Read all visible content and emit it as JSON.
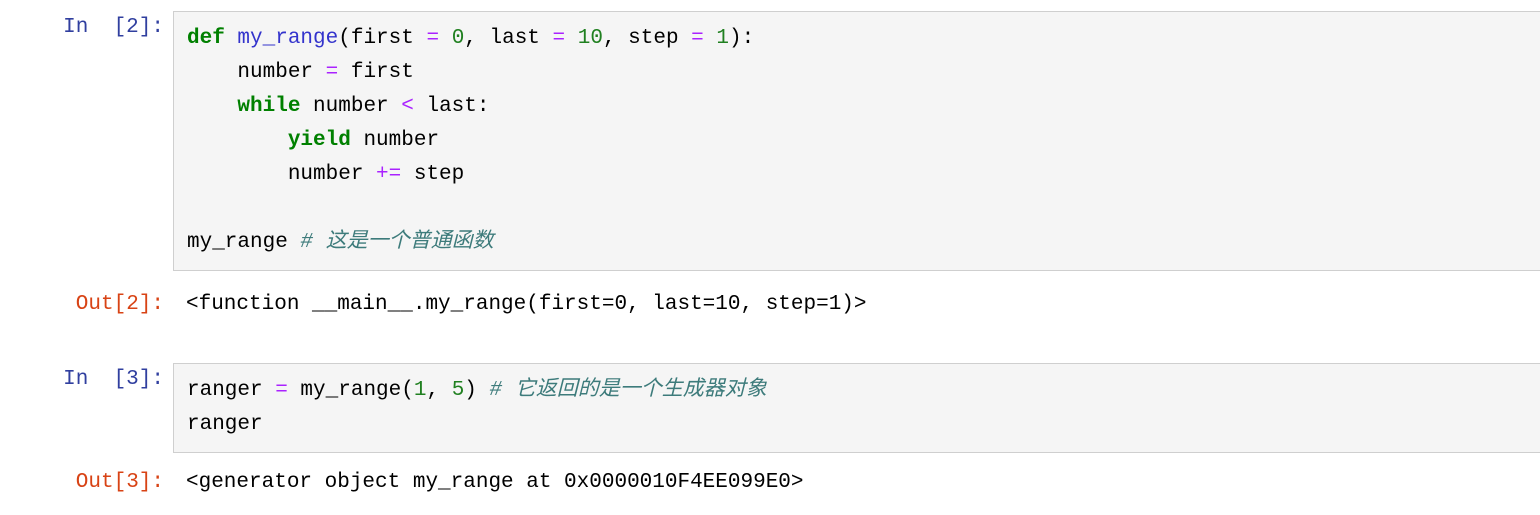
{
  "notebook": {
    "cells": [
      {
        "id": "cell-in-2",
        "type": "input",
        "prompt": "In  [2]:",
        "lines": [
          [
            {
              "t": "def ",
              "c": "kw"
            },
            {
              "t": "my_range",
              "c": "fn"
            },
            {
              "t": "(first ",
              "c": "plain"
            },
            {
              "t": "=",
              "c": "op"
            },
            {
              "t": " ",
              "c": "plain"
            },
            {
              "t": "0",
              "c": "num"
            },
            {
              "t": ", last ",
              "c": "plain"
            },
            {
              "t": "=",
              "c": "op"
            },
            {
              "t": " ",
              "c": "plain"
            },
            {
              "t": "10",
              "c": "num"
            },
            {
              "t": ", step ",
              "c": "plain"
            },
            {
              "t": "=",
              "c": "op"
            },
            {
              "t": " ",
              "c": "plain"
            },
            {
              "t": "1",
              "c": "num"
            },
            {
              "t": "):",
              "c": "plain"
            }
          ],
          [
            {
              "t": "    number ",
              "c": "plain"
            },
            {
              "t": "=",
              "c": "op"
            },
            {
              "t": " first",
              "c": "plain"
            }
          ],
          [
            {
              "t": "    ",
              "c": "plain"
            },
            {
              "t": "while",
              "c": "kw"
            },
            {
              "t": " number ",
              "c": "plain"
            },
            {
              "t": "<",
              "c": "op"
            },
            {
              "t": " last:",
              "c": "plain"
            }
          ],
          [
            {
              "t": "        ",
              "c": "plain"
            },
            {
              "t": "yield",
              "c": "kw"
            },
            {
              "t": " number",
              "c": "plain"
            }
          ],
          [
            {
              "t": "        number ",
              "c": "plain"
            },
            {
              "t": "+=",
              "c": "op"
            },
            {
              "t": " step",
              "c": "plain"
            }
          ],
          [
            {
              "t": "",
              "c": "plain"
            }
          ],
          [
            {
              "t": "my_range ",
              "c": "plain"
            },
            {
              "t": "# 这是一个普通函数",
              "c": "comment"
            }
          ]
        ]
      },
      {
        "id": "cell-out-2",
        "type": "output",
        "prompt": "Out[2]:",
        "text": "<function __main__.my_range(first=0, last=10, step=1)>"
      },
      {
        "id": "cell-in-3",
        "type": "input",
        "prompt": "In  [3]:",
        "lines": [
          [
            {
              "t": "ranger ",
              "c": "plain"
            },
            {
              "t": "=",
              "c": "op"
            },
            {
              "t": " my_range(",
              "c": "plain"
            },
            {
              "t": "1",
              "c": "num"
            },
            {
              "t": ", ",
              "c": "plain"
            },
            {
              "t": "5",
              "c": "num"
            },
            {
              "t": ") ",
              "c": "plain"
            },
            {
              "t": "# 它返回的是一个生成器对象",
              "c": "comment"
            }
          ],
          [
            {
              "t": "ranger",
              "c": "plain"
            }
          ]
        ]
      },
      {
        "id": "cell-out-3",
        "type": "output",
        "prompt": "Out[3]:",
        "text": "<generator object my_range at 0x0000010F4EE099E0>"
      }
    ]
  },
  "colors": {
    "keyword": "#008000",
    "function_name": "#3333cc",
    "number": "#208020",
    "operator": "#aa22ff",
    "comment": "#3d7b7b",
    "prompt_in": "#303f9f",
    "prompt_out": "#d84315",
    "cell_background": "#f5f5f5",
    "cell_border": "#cfcfcf"
  }
}
